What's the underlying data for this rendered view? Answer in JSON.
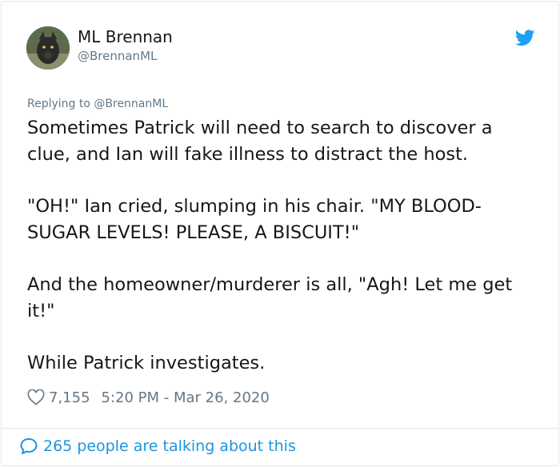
{
  "author": {
    "name": "ML Brennan",
    "handle": "@BrennanML"
  },
  "reply_context": {
    "prefix": "Replying to",
    "mention": "@BrennanML"
  },
  "tweet": {
    "paragraphs": [
      "Sometimes Patrick will need to search to discover a clue, and Ian will fake illness to distract the host.",
      "\"OH!\" Ian cried, slumping in his chair. \"MY BLOOD-SUGAR LEVELS! PLEASE, A BISCUIT!\"",
      "And the homeowner/murderer is all, \"Agh! Let me get it!\"",
      "While Patrick investigates."
    ],
    "likes": "7,155",
    "timestamp": "5:20 PM - Mar 26, 2020"
  },
  "footer": {
    "talking_label": "265 people are talking about this"
  },
  "icons": {
    "brand": "twitter-bird-icon",
    "like": "heart-icon",
    "comment": "speech-bubble-icon"
  },
  "colors": {
    "twitter_blue": "#1da1f2",
    "link_blue": "#1b95e0",
    "secondary_text": "#657786",
    "primary_text": "#14171a",
    "border": "#e1e8ed"
  }
}
